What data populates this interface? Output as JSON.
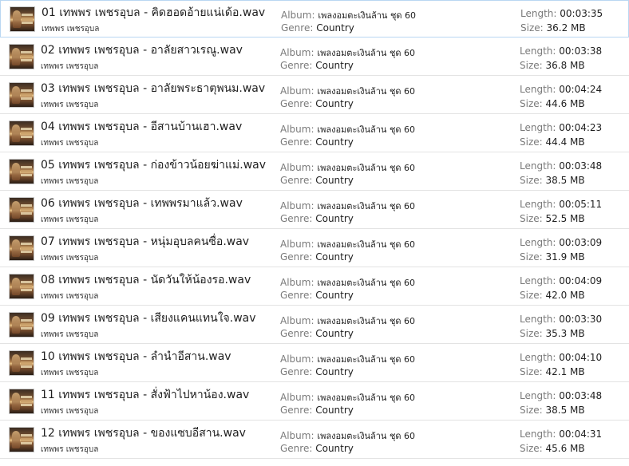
{
  "labels": {
    "album": "Album:",
    "genre": "Genre:",
    "length": "Length:",
    "size": "Size:"
  },
  "files": [
    {
      "name": "01 เทพพร เพชรอุบล - คิดฮอดอ้ายแน่เด้อ.wav",
      "artist": "เทพพร เพชรอุบล",
      "album": "เพลงอมตะเงินล้าน ชุด 60",
      "genre": "Country",
      "length": "00:03:35",
      "size": "36.2 MB"
    },
    {
      "name": "02 เทพพร เพชรอุบล - อาลัยสาวเรณู.wav",
      "artist": "เทพพร เพชรอุบล",
      "album": "เพลงอมตะเงินล้าน ชุด 60",
      "genre": "Country",
      "length": "00:03:38",
      "size": "36.8 MB"
    },
    {
      "name": "03 เทพพร เพชรอุบล - อาลัยพระธาตุพนม.wav",
      "artist": "เทพพร เพชรอุบล",
      "album": "เพลงอมตะเงินล้าน ชุด 60",
      "genre": "Country",
      "length": "00:04:24",
      "size": "44.6 MB"
    },
    {
      "name": "04 เทพพร เพชรอุบล - อีสานบ้านเฮา.wav",
      "artist": "เทพพร เพชรอุบล",
      "album": "เพลงอมตะเงินล้าน ชุด 60",
      "genre": "Country",
      "length": "00:04:23",
      "size": "44.4 MB"
    },
    {
      "name": "05 เทพพร เพชรอุบล - ก่องข้าวน้อยฆ่าแม่.wav",
      "artist": "เทพพร เพชรอุบล",
      "album": "เพลงอมตะเงินล้าน ชุด 60",
      "genre": "Country",
      "length": "00:03:48",
      "size": "38.5 MB"
    },
    {
      "name": "06 เทพพร เพชรอุบล - เทพพรมาแล้ว.wav",
      "artist": "เทพพร เพชรอุบล",
      "album": "เพลงอมตะเงินล้าน ชุด 60",
      "genre": "Country",
      "length": "00:05:11",
      "size": "52.5 MB"
    },
    {
      "name": "07 เทพพร เพชรอุบล - หนุ่มอุบลคนซื่อ.wav",
      "artist": "เทพพร เพชรอุบล",
      "album": "เพลงอมตะเงินล้าน ชุด 60",
      "genre": "Country",
      "length": "00:03:09",
      "size": "31.9 MB"
    },
    {
      "name": "08 เทพพร เพชรอุบล - นัดวันให้น้องรอ.wav",
      "artist": "เทพพร เพชรอุบล",
      "album": "เพลงอมตะเงินล้าน ชุด 60",
      "genre": "Country",
      "length": "00:04:09",
      "size": "42.0 MB"
    },
    {
      "name": "09 เทพพร เพชรอุบล - เสียงแคนแทนใจ.wav",
      "artist": "เทพพร เพชรอุบล",
      "album": "เพลงอมตะเงินล้าน ชุด 60",
      "genre": "Country",
      "length": "00:03:30",
      "size": "35.3 MB"
    },
    {
      "name": "10 เทพพร เพชรอุบล - ลำนำอีสาน.wav",
      "artist": "เทพพร เพชรอุบล",
      "album": "เพลงอมตะเงินล้าน ชุด 60",
      "genre": "Country",
      "length": "00:04:10",
      "size": "42.1 MB"
    },
    {
      "name": "11 เทพพร เพชรอุบล - สั่งฟ้าไปหาน้อง.wav",
      "artist": "เทพพร เพชรอุบล",
      "album": "เพลงอมตะเงินล้าน ชุด 60",
      "genre": "Country",
      "length": "00:03:48",
      "size": "38.5 MB"
    },
    {
      "name": "12 เทพพร เพชรอุบล - ของแซบอีสาน.wav",
      "artist": "เทพพร เพชรอุบล",
      "album": "เพลงอมตะเงินล้าน ชุด 60",
      "genre": "Country",
      "length": "00:04:31",
      "size": "45.6 MB"
    }
  ]
}
